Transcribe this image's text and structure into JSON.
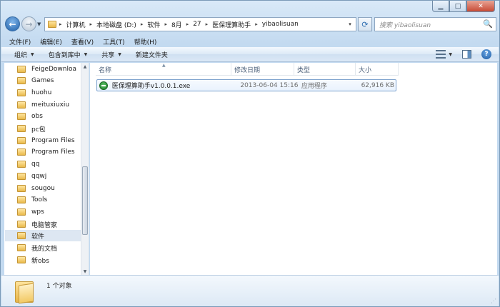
{
  "window": {
    "controls": {
      "minimize": "▁",
      "maximize": "□",
      "close": "✕"
    }
  },
  "address_bar": {
    "crumbs": [
      "计算机",
      "本地磁盘 (D:)",
      "软件",
      "8月",
      "27",
      "医保理算助手",
      "yibaolisuan"
    ],
    "separator": "▸",
    "dropdown": "▾"
  },
  "search": {
    "placeholder": "搜索 yibaolisuan",
    "icon": "🔍"
  },
  "menu": [
    "文件(F)",
    "编辑(E)",
    "查看(V)",
    "工具(T)",
    "帮助(H)"
  ],
  "toolbar": {
    "organize": "组织",
    "include_in_library": "包含到库中",
    "share": "共享",
    "new_folder": "新建文件夹",
    "caret": "▼"
  },
  "nav_tree": [
    {
      "label": "FeigeDownloa"
    },
    {
      "label": "Games"
    },
    {
      "label": "huohu"
    },
    {
      "label": "meituxiuxiu"
    },
    {
      "label": "obs"
    },
    {
      "label": "pc包"
    },
    {
      "label": "Program Files"
    },
    {
      "label": "Program Files"
    },
    {
      "label": "qq"
    },
    {
      "label": "qqwj"
    },
    {
      "label": "sougou"
    },
    {
      "label": "Tools"
    },
    {
      "label": "wps"
    },
    {
      "label": "电脑管家"
    },
    {
      "label": "软件",
      "selected": true
    },
    {
      "label": "我的文档"
    },
    {
      "label": "新obs"
    }
  ],
  "columns": {
    "name": "名称",
    "modified": "修改日期",
    "type": "类型",
    "size": "大小"
  },
  "files": [
    {
      "name": "医保理算助手v1.0.0.1.exe",
      "modified": "2013-06-04 15:16",
      "type": "应用程序",
      "size": "62,916 KB",
      "icon": "exe-icon"
    }
  ],
  "status": {
    "text": "1 个对象"
  },
  "colors": {
    "accent": "#1f5fa8",
    "selection": "#dde7f2",
    "row_border": "#7da2ce"
  }
}
